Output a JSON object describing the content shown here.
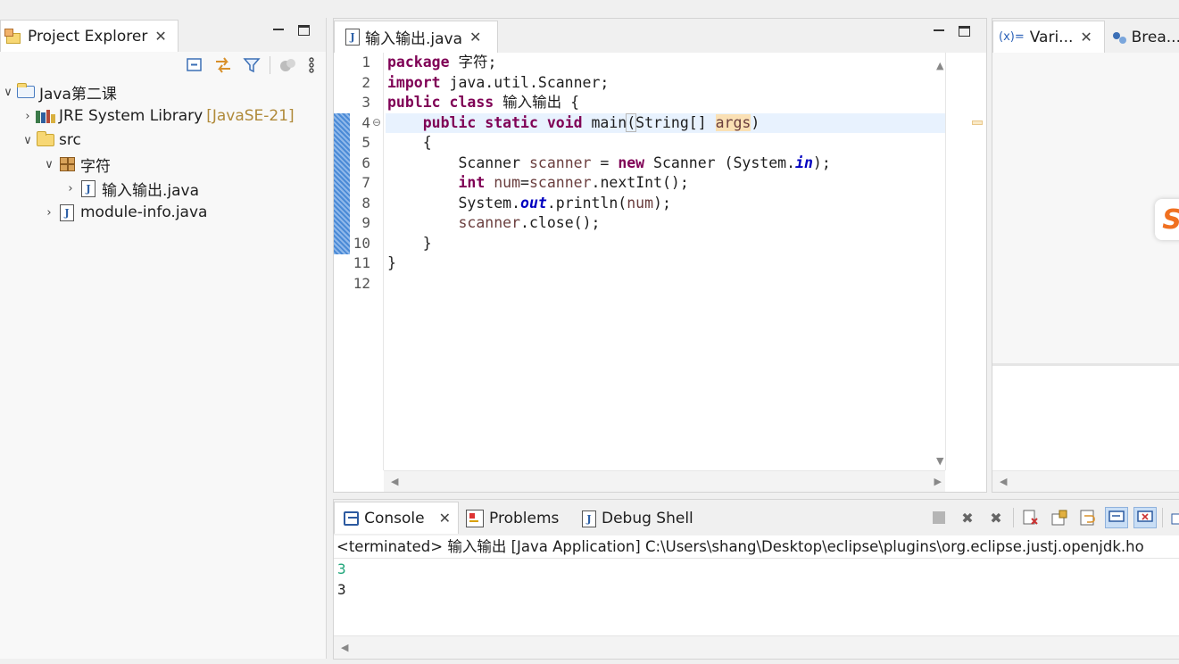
{
  "project_explorer": {
    "tab_label": "Project Explorer",
    "tree": [
      {
        "label": "Java第二课",
        "decor": "",
        "icon": "project-folder-icon",
        "expanded": true
      },
      {
        "label": "JRE System Library",
        "decor": "[JavaSE-21]",
        "icon": "library-icon",
        "expanded": false
      },
      {
        "label": "src",
        "decor": "",
        "icon": "source-folder-icon",
        "expanded": true
      },
      {
        "label": "字符",
        "decor": "",
        "icon": "package-icon",
        "expanded": true
      },
      {
        "label": "输入输出.java",
        "decor": "",
        "icon": "java-file-icon",
        "expanded": false
      },
      {
        "label": "module-info.java",
        "decor": "",
        "icon": "java-file-icon",
        "expanded": false
      }
    ]
  },
  "editor": {
    "tab_label": "输入输出.java",
    "line_numbers": [
      "1",
      "2",
      "3",
      "4",
      "5",
      "6",
      "7",
      "8",
      "9",
      "10",
      "11",
      "12"
    ],
    "code": {
      "l1_kw": "package",
      "l1_rest": " 字符;",
      "l2_kw": "import",
      "l2_rest": " java.util.Scanner;",
      "l3_kw1": "public",
      "l3_kw2": "class",
      "l3_rest": " 输入输出 {",
      "l4_indent": "    ",
      "l4_kw": "public static void",
      "l4_a": " main",
      "l4_paren": "(",
      "l4_b": "String[] ",
      "l4_arg": "args",
      "l4_c": ")",
      "l5": "    {",
      "l6_a": "        Scanner ",
      "l6_var": "scanner",
      "l6_b": " = ",
      "l6_kw": "new",
      "l6_c": " Scanner (System.",
      "l6_field": "in",
      "l6_d": ");",
      "l7_indent": "        ",
      "l7_kw": "int",
      "l7_a": " ",
      "l7_var": "num",
      "l7_b": "=",
      "l7_var2": "scanner",
      "l7_c": ".nextInt();",
      "l8_a": "        System.",
      "l8_field": "out",
      "l8_b": ".println(",
      "l8_var": "num",
      "l8_c": ");",
      "l9_indent": "        ",
      "l9_var": "scanner",
      "l9_a": ".close();",
      "l10": "    }",
      "l11": "}",
      "l12": ""
    }
  },
  "right_pane": {
    "tab_variables": "Vari...",
    "tab_breakpoints": "Brea...",
    "variables_icon": "(x)=",
    "logo_letter": "S"
  },
  "console": {
    "tab_console": "Console",
    "tab_problems": "Problems",
    "tab_debug_shell": "Debug Shell",
    "terminated_line": "<terminated> 输入输出 [Java Application] C:\\Users\\shang\\Desktop\\eclipse\\plugins\\org.eclipse.justj.openjdk.ho",
    "input_echo": "3",
    "output": "3"
  },
  "colors": {
    "keyword": "#7f0055",
    "static_field": "#0000c0",
    "local_var": "#6a3e3e",
    "stdin_echo": "#1fa67a",
    "current_line": "#e8f2fe"
  }
}
